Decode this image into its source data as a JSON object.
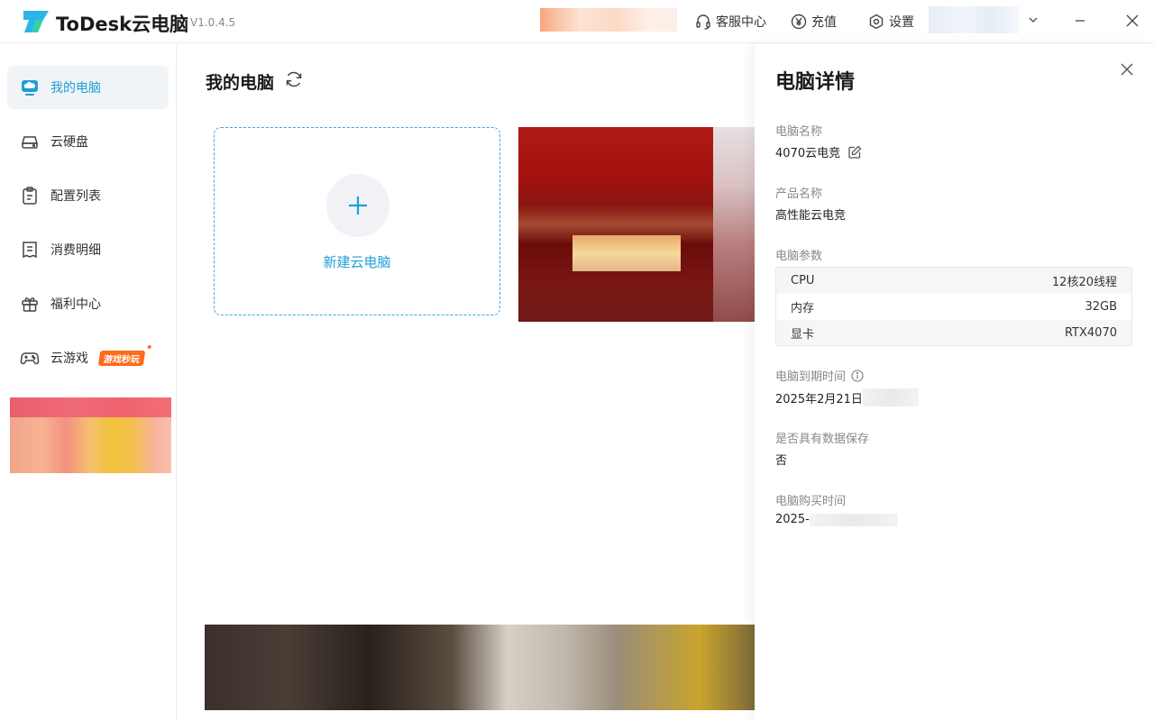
{
  "app": {
    "name": "ToDesk云电脑",
    "version": "V1.0.4.5",
    "brand_color": "#1e9ed8"
  },
  "titlebar": {
    "support_label": "客服中心",
    "recharge_label": "充值",
    "settings_label": "设置",
    "support_icon": "headset-icon",
    "recharge_icon": "yen-icon",
    "settings_icon": "gear-icon"
  },
  "sidebar": {
    "items": [
      {
        "label": "我的电脑",
        "icon": "cloud-monitor-icon",
        "active": true
      },
      {
        "label": "云硬盘",
        "icon": "disk-icon",
        "active": false
      },
      {
        "label": "配置列表",
        "icon": "clipboard-icon",
        "active": false
      },
      {
        "label": "消费明细",
        "icon": "receipt-icon",
        "active": false
      },
      {
        "label": "福利中心",
        "icon": "gift-icon",
        "active": false
      },
      {
        "label": "云游戏",
        "icon": "gamepad-icon",
        "active": false,
        "badge": "游戏秒玩"
      }
    ]
  },
  "main": {
    "title": "我的电脑",
    "new_pc_label": "新建云电脑"
  },
  "details": {
    "title": "电脑详情",
    "name_label": "电脑名称",
    "name_value": "4070云电竞",
    "product_label": "产品名称",
    "product_value": "高性能云电竞",
    "params_label": "电脑参数",
    "specs": [
      {
        "key": "CPU",
        "value": "12核20线程"
      },
      {
        "key": "内存",
        "value": "32GB"
      },
      {
        "key": "显卡",
        "value": "RTX4070"
      }
    ],
    "expiry_label": "电脑到期时间",
    "expiry_value": "2025年2月21日",
    "data_save_label": "是否具有数据保存",
    "data_save_value": "否",
    "purchase_label": "电脑购买时间",
    "purchase_value": "2025-"
  }
}
